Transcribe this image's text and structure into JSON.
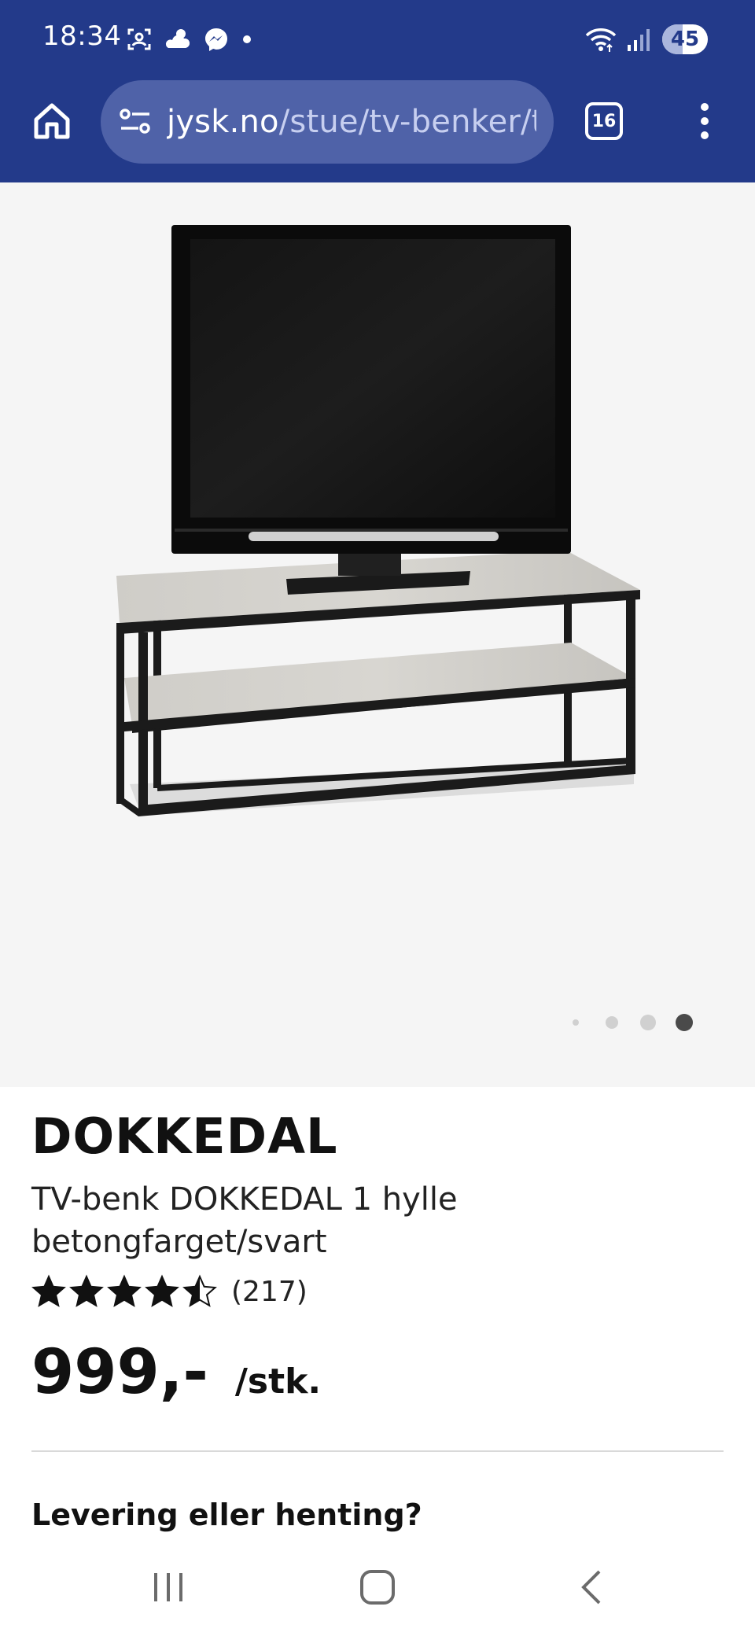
{
  "status_bar": {
    "time": "18:34",
    "battery": "45",
    "battery_level": 0.45
  },
  "browser": {
    "url_host": "jysk.no",
    "url_path": "/stue/tv-benker/tv",
    "tab_count": "16"
  },
  "gallery": {
    "image_count": 4,
    "active_index": 3
  },
  "product": {
    "brand": "DOKKEDAL",
    "subtitle": "TV-benk DOKKEDAL 1 hylle betongfarget/svart",
    "rating": 4.5,
    "rating_max": 5,
    "review_count": "(217)",
    "price": "999,-",
    "price_unit": "/stk.",
    "delivery_heading": "Levering eller henting?"
  },
  "colors": {
    "chrome_blue": "#233a8a",
    "url_bar": "#4f62a8",
    "gallery_bg": "#f5f5f5",
    "text": "#111111"
  }
}
